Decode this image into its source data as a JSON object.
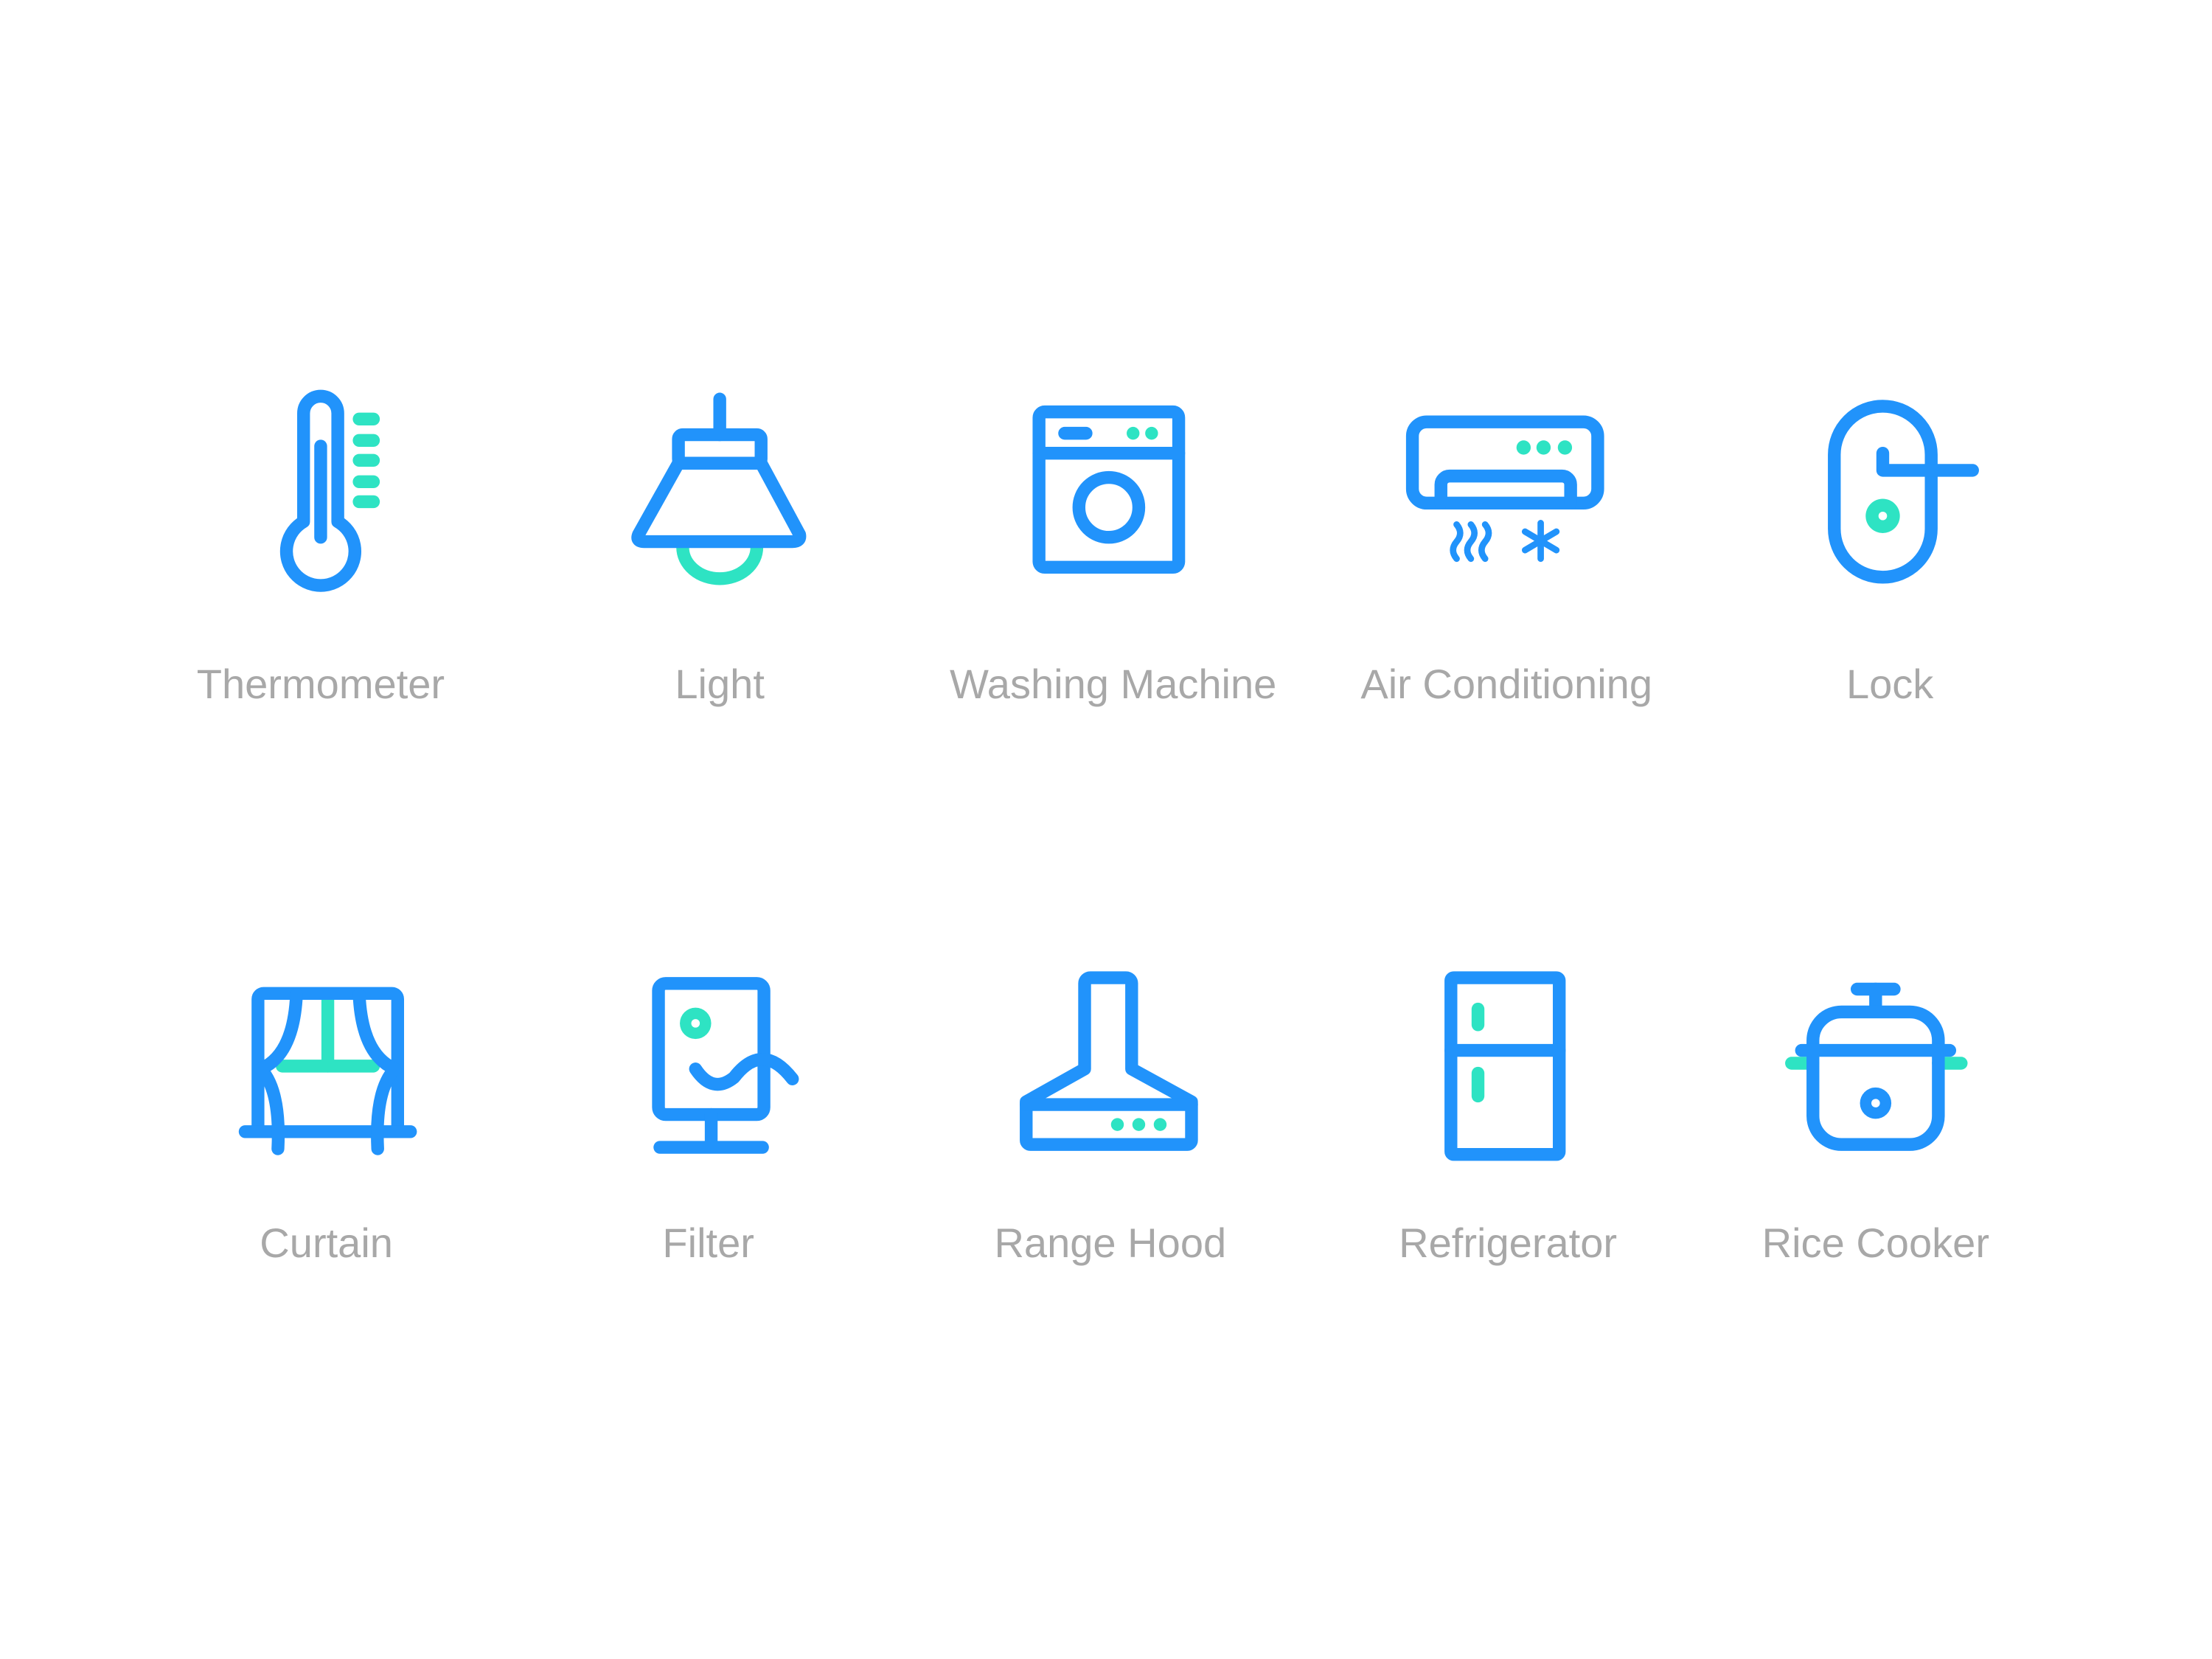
{
  "colors": {
    "primary": "#2193fb",
    "accent": "#2ee3c3",
    "label": "#a8a8a8",
    "background": "#ffffff"
  },
  "icons": [
    {
      "label": "Thermometer",
      "icon": "thermometer-icon"
    },
    {
      "label": "Light",
      "icon": "pendant-light-icon"
    },
    {
      "label": "Washing Machine",
      "icon": "washing-machine-icon"
    },
    {
      "label": "Air Conditioning",
      "icon": "air-conditioner-icon"
    },
    {
      "label": "Lock",
      "icon": "door-lock-icon"
    },
    {
      "label": "Curtain",
      "icon": "curtain-icon"
    },
    {
      "label": "Filter",
      "icon": "water-filter-icon"
    },
    {
      "label": "Range Hood",
      "icon": "range-hood-icon"
    },
    {
      "label": "Refrigerator",
      "icon": "refrigerator-icon"
    },
    {
      "label": "Rice Cooker",
      "icon": "rice-cooker-icon"
    }
  ]
}
